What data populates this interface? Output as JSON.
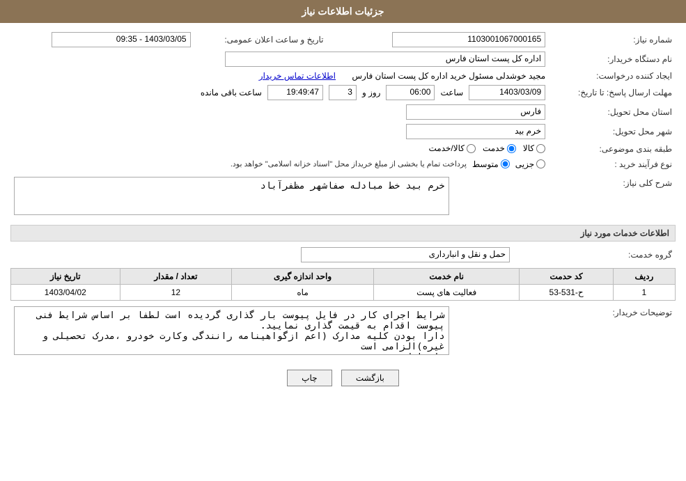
{
  "header": {
    "title": "جزئیات اطلاعات نیاز"
  },
  "fields": {
    "need_number_label": "شماره نیاز:",
    "need_number_value": "1103001067000165",
    "announce_datetime_label": "تاریخ و ساعت اعلان عمومی:",
    "announce_datetime_value": "1403/03/05 - 09:35",
    "buyer_org_label": "نام دستگاه خریدار:",
    "buyer_org_value": "اداره کل پست استان فارس",
    "creator_label": "ایجاد کننده درخواست:",
    "creator_value": "مجید خوشدلی مسئول خرید اداره کل پست استان فارس",
    "contact_link": "اطلاعات تماس خریدار",
    "reply_deadline_label": "مهلت ارسال پاسخ: تا تاریخ:",
    "reply_date_value": "1403/03/09",
    "reply_time_label": "ساعت",
    "reply_time_value": "06:00",
    "reply_days_label": "روز و",
    "reply_days_value": "3",
    "reply_remaining_label": "ساعت باقی مانده",
    "reply_remaining_value": "19:49:47",
    "province_label": "استان محل تحویل:",
    "province_value": "فارس",
    "city_label": "شهر محل تحویل:",
    "city_value": "خرم بید",
    "category_label": "طبقه بندی موضوعی:",
    "category_options": [
      "کالا",
      "خدمت",
      "کالا/خدمت"
    ],
    "category_selected": "خدمت",
    "purchase_type_label": "نوع فرآیند خرید :",
    "purchase_type_options": [
      "جزیی",
      "متوسط"
    ],
    "purchase_type_note": "پرداخت تمام یا بخشی از مبلغ خریداز محل \"اسناد خزانه اسلامی\" خواهد بود.",
    "description_label": "شرح کلی نیاز:",
    "description_value": "خرم بید خط مبادله صفاشهر مظفرآباد",
    "services_section_title": "اطلاعات خدمات مورد نیاز",
    "service_group_label": "گروه خدمت:",
    "service_group_value": "حمل و نقل و انبارداری",
    "table": {
      "headers": [
        "ردیف",
        "کد حدمت",
        "نام خدمت",
        "واحد اندازه گیری",
        "تعداد / مقدار",
        "تاریخ نیاز"
      ],
      "rows": [
        {
          "row": "1",
          "code": "ح-531-53",
          "name": "فعالیت های پست",
          "unit": "ماه",
          "quantity": "12",
          "date": "1403/04/02"
        }
      ]
    },
    "buyer_notes_label": "توضیحات خریدار:",
    "buyer_notes_value": "شرایط اجرای کار در فایل پیوست بار گذاری گردیده است لطفا بر اساس شرایط فنی پیوست اقدام به قیمت گذاری نمایید.\nدارا بودن کلیه مدارک (اعم ازگواهینامه رانندگی وکارت خودرو ،مدرک تحصیلی و غیره)الزامی است\nبار اول"
  },
  "buttons": {
    "print_label": "چاپ",
    "back_label": "بازگشت"
  }
}
